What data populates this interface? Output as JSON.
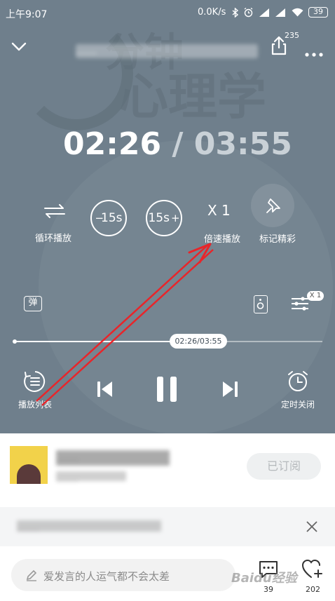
{
  "status_bar": {
    "time": "上午9:07",
    "network_speed": "0.0K/s",
    "battery": "39"
  },
  "header": {
    "title": "……",
    "share_count": "235"
  },
  "background": {
    "title_line1": "分钟",
    "title_line2": "心理学"
  },
  "timer": {
    "current": "02:26",
    "separator": "/",
    "total": "03:55",
    "progress": 0.62
  },
  "controls": {
    "loop_label": "循环播放",
    "rewind_text": "15s",
    "forward_text": "15s",
    "speed_value": "X 1",
    "speed_label": "倍速播放",
    "mark_label": "标记精彩"
  },
  "secondary": {
    "danmaku_icon": "弹",
    "eq_badge": "X 1"
  },
  "progress_tooltip": "02:26/03:55",
  "playback": {
    "playlist_label": "播放列表",
    "timer_label": "定时关闭"
  },
  "album": {
    "name": "……",
    "meta": "……",
    "subscribe_label": "已订阅"
  },
  "notice": {
    "text": "……"
  },
  "comment_bar": {
    "placeholder": "爱发言的人运气都不会太差",
    "comment_count": "39",
    "like_count": "202"
  },
  "watermark": "Baidu经验"
}
